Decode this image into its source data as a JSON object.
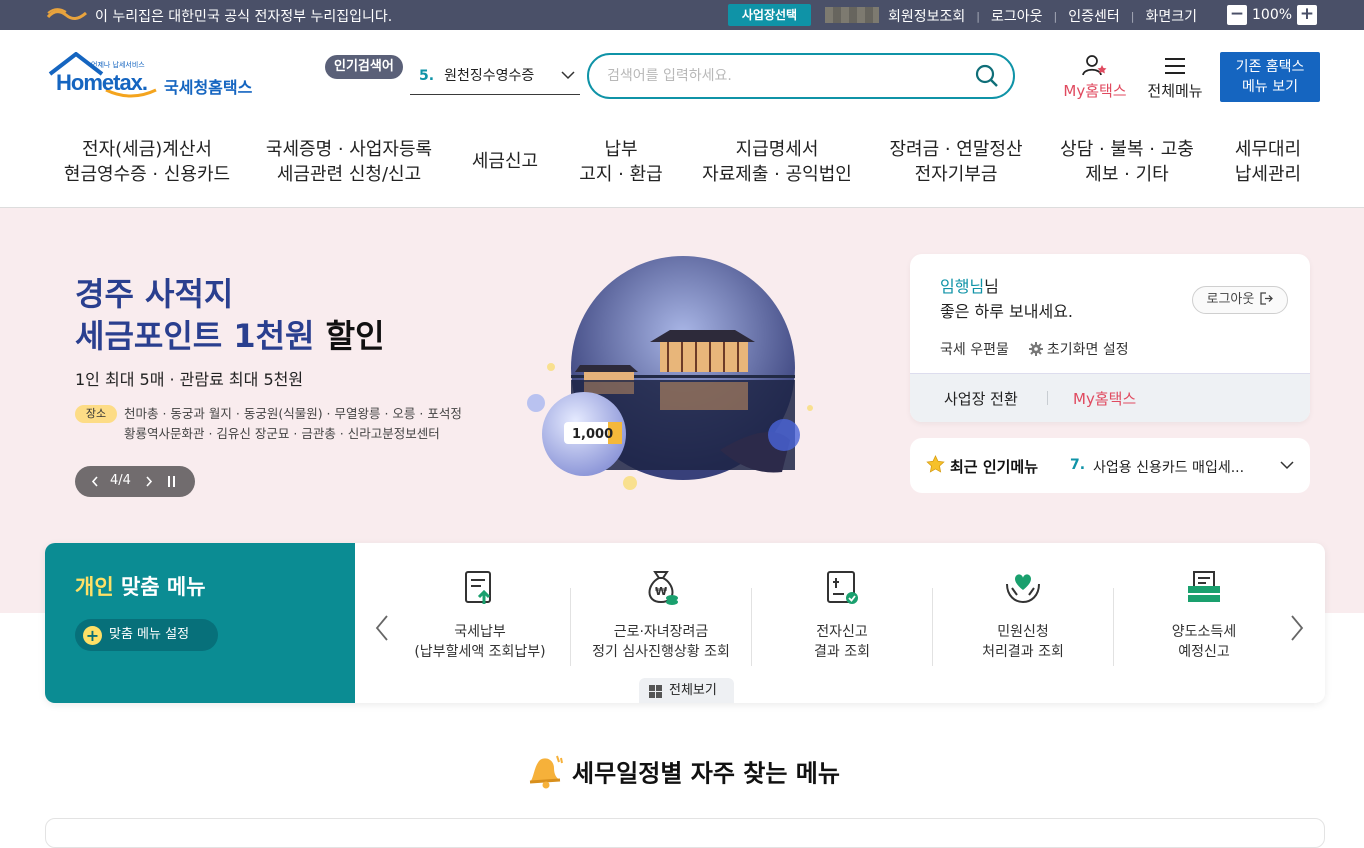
{
  "topbar": {
    "gov_notice": "이 누리집은 대한민국 공식 전자정부 누리집입니다.",
    "biz_select": "사업장선택",
    "links": [
      "회원정보조회",
      "로그아웃",
      "인증센터",
      "화면크기"
    ],
    "zoom_minus": "−",
    "zoom_value": "100%",
    "zoom_plus": "+"
  },
  "logo": {
    "small": "언제나 납세서비스",
    "brand": "Hometax.",
    "name": "국세청홈택스"
  },
  "search": {
    "popular_badge": "인기검색어",
    "popular_rank": "5.",
    "popular_term": "원천징수영수증",
    "placeholder": "검색어를 입력하세요."
  },
  "header_links": {
    "my_hometax": "My홈택스",
    "all_menu": "전체메뉴",
    "old_menu_line1": "기존 홈택스",
    "old_menu_line2": "메뉴 보기"
  },
  "gnb": [
    {
      "line1": "전자(세금)계산서",
      "line2": "현금영수증 · 신용카드"
    },
    {
      "line1": "국세증명 · 사업자등록",
      "line2": "세금관련 신청/신고"
    },
    {
      "line1": "세금신고",
      "line2": ""
    },
    {
      "line1": "납부",
      "line2": "고지 · 환급"
    },
    {
      "line1": "지급명세서",
      "line2": "자료제출 · 공익법인"
    },
    {
      "line1": "장려금 · 연말정산",
      "line2": "전자기부금"
    },
    {
      "line1": "상담 · 불복 · 고충",
      "line2": "제보 · 기타"
    },
    {
      "line1": "세무대리",
      "line2": "납세관리"
    }
  ],
  "hero": {
    "title_line1": "경주 사적지",
    "title_line2_blue": "세금포인트 1천원",
    "title_line2_dark": " 할인",
    "subtitle": "1인 최대 5매 · 관람료 최대 5천원",
    "tag": "장소",
    "places_line1": "천마총 · 동궁과 월지 · 동궁원(식물원) · 무열왕릉 · 오릉 · 포석정",
    "places_line2": "황룡역사문화관 · 김유신 장군묘 · 금관총 · 신라고분정보센터",
    "pager": "4/4",
    "coin_label": "1,000"
  },
  "user_card": {
    "name": "임행님",
    "name_suffix": "님",
    "greeting": "좋은 하루 보내세요.",
    "logout": "로그아웃",
    "mail": "국세 우편물",
    "home_setting": "초기화면 설정",
    "switch_biz": "사업장 전환",
    "my_hometax": "My홈택스"
  },
  "recent": {
    "label": "최근 인기메뉴",
    "rank": "7.",
    "item": "사업용 신용카드 매입세..."
  },
  "custom_menu": {
    "title_yellow": "개인",
    "title_white": " 맞춤 메뉴",
    "setting": "맞춤 메뉴 설정",
    "view_all": "전체보기",
    "items": [
      {
        "line1": "국세납부",
        "line2": "(납부할세액 조회납부)",
        "icon": "tax-payment-icon"
      },
      {
        "line1": "근로·자녀장려금",
        "line2": "정기 심사진행상황 조회",
        "icon": "money-bag-icon"
      },
      {
        "line1": "전자신고",
        "line2": "결과 조회",
        "icon": "e-filing-icon"
      },
      {
        "line1": "민원신청",
        "line2": "처리결과 조회",
        "icon": "heart-hands-icon"
      },
      {
        "line1": "양도소득세",
        "line2": "예정신고",
        "icon": "folder-document-icon"
      }
    ]
  },
  "schedule": {
    "title": "세무일정별 자주 찾는 메뉴"
  },
  "colors": {
    "teal": "#0f93a7",
    "navy": "#4a5068",
    "pink_bg": "#f9ecee",
    "my_red": "#e04a5f"
  }
}
